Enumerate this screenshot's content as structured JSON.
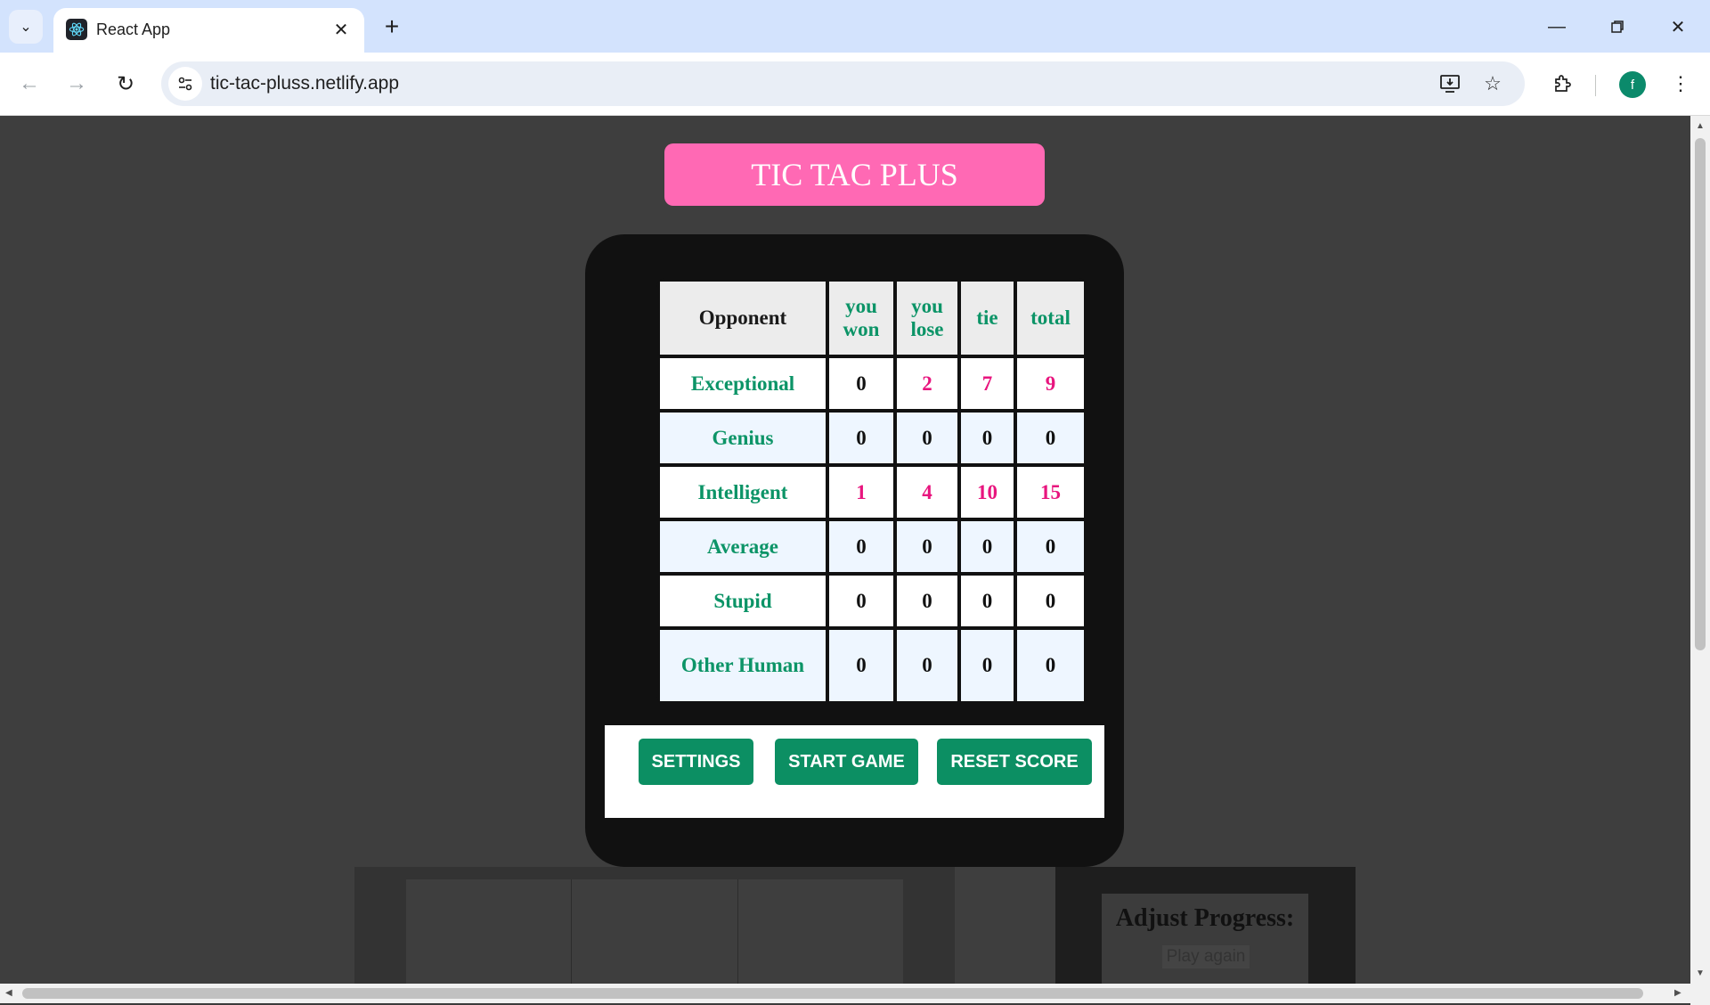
{
  "browser": {
    "tab_title": "React App",
    "url": "tic-tac-pluss.netlify.app",
    "profile_initial": "f"
  },
  "page": {
    "title": "TIC TAC PLUS",
    "table": {
      "headers": [
        "Opponent",
        "you won",
        "you lose",
        "tie",
        "total"
      ],
      "rows": [
        {
          "opponent": "Exceptional",
          "won": "0",
          "lose": "2",
          "tie": "7",
          "total": "9"
        },
        {
          "opponent": "Genius",
          "won": "0",
          "lose": "0",
          "tie": "0",
          "total": "0"
        },
        {
          "opponent": "Intelligent",
          "won": "1",
          "lose": "4",
          "tie": "10",
          "total": "15"
        },
        {
          "opponent": "Average",
          "won": "0",
          "lose": "0",
          "tie": "0",
          "total": "0"
        },
        {
          "opponent": "Stupid",
          "won": "0",
          "lose": "0",
          "tie": "0",
          "total": "0"
        },
        {
          "opponent": "Other Human",
          "won": "0",
          "lose": "0",
          "tie": "0",
          "total": "0"
        }
      ]
    },
    "buttons": {
      "settings": "SETTINGS",
      "start_game": "START GAME",
      "reset_score": "RESET SCORE"
    },
    "progress": {
      "title": "Adjust Progress:",
      "play_again": "Play again"
    }
  },
  "colors": {
    "banner": "#ff69b4",
    "accent_green": "#0c8f63",
    "highlight_pink": "#e8157e"
  }
}
